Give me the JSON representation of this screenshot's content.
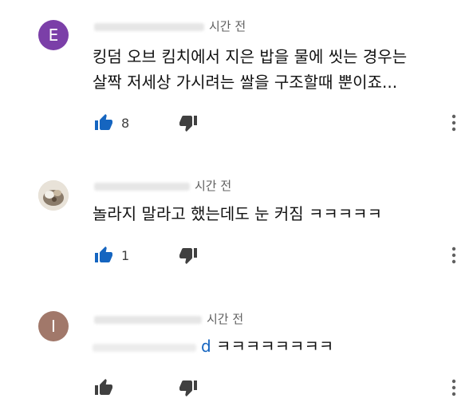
{
  "comments": [
    {
      "avatar_letter": "E",
      "avatar_color": "#7b3fa8",
      "time": "시간 전",
      "text_line1": "킹덤 오브 킴치에서 지은 밥을 물에 씻는 경우는",
      "text_line2": "살짝 저세상 가시려는 쌀을 구조할때 뿐이죠...",
      "like_count": "8",
      "liked": true
    },
    {
      "avatar_color": "#8a7b6a",
      "time": "시간 전",
      "text_line1": "놀라지 말라고 했는데도 눈 커짐 ㅋㅋㅋㅋㅋ",
      "like_count": "1",
      "liked": true
    },
    {
      "avatar_letter": "I",
      "avatar_color": "#a1786a",
      "time": "시간 전",
      "mention_tail": "d",
      "text_line1": " ㅋㅋㅋㅋㅋㅋㅋㅋ",
      "like_count": "",
      "liked": false
    }
  ],
  "colors": {
    "like_active": "#1565c0",
    "like_inactive": "#404040",
    "dislike": "#404040",
    "more": "#606060"
  },
  "icons": {
    "like": "thumbs-up-icon",
    "dislike": "thumbs-down-icon",
    "more": "more-vertical-icon"
  }
}
